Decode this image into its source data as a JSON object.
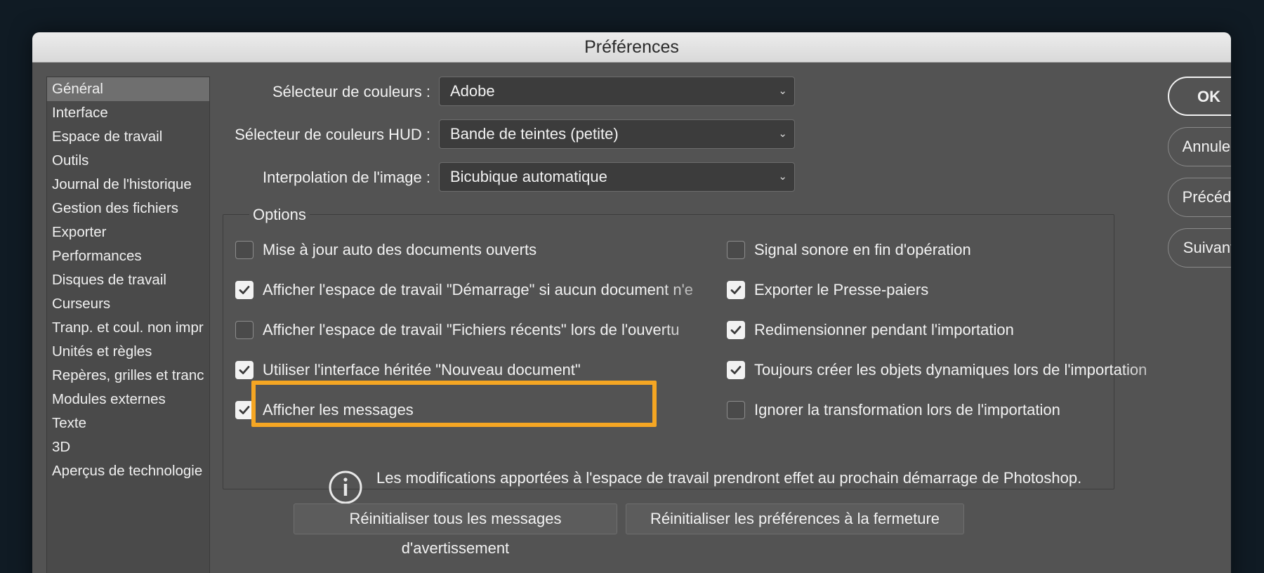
{
  "window": {
    "title": "Préférences"
  },
  "sidebar": {
    "selected": "Général",
    "items": [
      {
        "label": "Général"
      },
      {
        "label": "Interface"
      },
      {
        "label": "Espace de travail"
      },
      {
        "label": "Outils"
      },
      {
        "label": "Journal de l'historique"
      },
      {
        "label": "Gestion des fichiers"
      },
      {
        "label": "Exporter"
      },
      {
        "label": "Performances"
      },
      {
        "label": "Disques de travail"
      },
      {
        "label": "Curseurs"
      },
      {
        "label": "Tranp. et coul. non impr"
      },
      {
        "label": "Unités et règles"
      },
      {
        "label": "Repères, grilles et tranc"
      },
      {
        "label": "Modules externes"
      },
      {
        "label": "Texte"
      },
      {
        "label": "3D"
      },
      {
        "label": "Aperçus de technologie"
      }
    ]
  },
  "settings": {
    "color_picker": {
      "label": "Sélecteur de couleurs :",
      "value": "Adobe"
    },
    "hud_color_picker": {
      "label": "Sélecteur de couleurs HUD :",
      "value": "Bande de teintes (petite)"
    },
    "image_interpolation": {
      "label": "Interpolation de l'image :",
      "value": "Bicubique automatique"
    }
  },
  "options": {
    "title": "Options",
    "left": [
      {
        "label": "Mise à jour auto des documents ouverts",
        "checked": false
      },
      {
        "label": "Afficher l'espace de travail \"Démarrage\" si aucun document n'e",
        "checked": true
      },
      {
        "label": "Afficher l'espace de travail \"Fichiers récents\" lors de l'ouvertu",
        "checked": false
      },
      {
        "label": "Utiliser l'interface héritée \"Nouveau document\"",
        "checked": true
      },
      {
        "label": "Afficher les messages",
        "checked": true
      }
    ],
    "right": [
      {
        "label": "Signal sonore en fin d'opération",
        "checked": false
      },
      {
        "label": "Exporter le Presse-paiers",
        "checked": true
      },
      {
        "label": "Redimensionner pendant l'importation",
        "checked": true
      },
      {
        "label": "Toujours créer les objets dynamiques lors de l'importation",
        "checked": true
      },
      {
        "label": "Ignorer la transformation lors de l'importation",
        "checked": false
      }
    ],
    "info": "Les modifications apportées à l'espace de travail prendront effet au prochain démarrage de Photoshop."
  },
  "reset_buttons": {
    "warnings": "Réinitialiser tous les messages d'avertissement",
    "prefs": "Réinitialiser les préférences à la fermeture"
  },
  "actions": {
    "ok": "OK",
    "cancel": "Annuler",
    "prev": "Précéd.",
    "next": "Suivant"
  },
  "colors": {
    "highlight": "#f5a623",
    "panel": "#535353"
  }
}
